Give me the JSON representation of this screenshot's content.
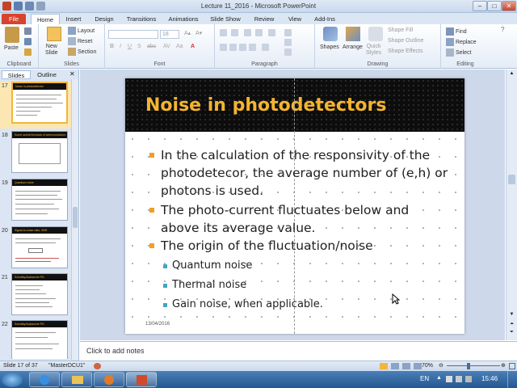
{
  "window": {
    "title": "Lecture 11_2016  -  Microsoft PowerPoint",
    "min": "–",
    "max": "□",
    "close": "✕"
  },
  "tabs": [
    "File",
    "Home",
    "Insert",
    "Design",
    "Transitions",
    "Animations",
    "Slide Show",
    "Review",
    "View",
    "Add-Ins"
  ],
  "ribbon": {
    "clipboard": {
      "label": "Clipboard",
      "paste": "Paste"
    },
    "slides": {
      "label": "Slides",
      "new_slide": "New\nSlide",
      "layout": "Layout",
      "reset": "Reset",
      "section": "Section"
    },
    "font": {
      "label": "Font",
      "size": "18"
    },
    "paragraph": {
      "label": "Paragraph"
    },
    "drawing": {
      "label": "Drawing",
      "shapes": "Shapes",
      "arrange": "Arrange",
      "quick_styles": "Quick\nStyles",
      "shape_fill": "Shape Fill",
      "shape_outline": "Shape Outline",
      "shape_effects": "Shape Effects"
    },
    "editing": {
      "label": "Editing",
      "find": "Find",
      "replace": "Replace",
      "select": "Select"
    }
  },
  "panel": {
    "tab_slides": "Slides",
    "tab_outline": "Outline",
    "thumbs": [
      {
        "num": "17",
        "title": "Noise in photodetector"
      },
      {
        "num": "18",
        "title": "Some useful formulas of semiconductors"
      },
      {
        "num": "19",
        "title": "Quantum noise"
      },
      {
        "num": "20",
        "title": "Signal-to-noise ratio, SNR"
      },
      {
        "num": "21",
        "title": "Schottky/Avalanche PD"
      },
      {
        "num": "22",
        "title": "Schottky/Avalanche PD"
      }
    ]
  },
  "slide": {
    "title": "Noise in photodetectors",
    "bullets": [
      "In the calculation of the responsivity of the",
      "photodetecor, the average number of (e,h) or",
      "photons is used.",
      "The photo-current fluctuates below and",
      "above its average value.",
      "The origin of the fluctuation/noise"
    ],
    "subbullets": [
      "Quantum noise",
      "Thermal noise",
      "Gain noise, when applicable."
    ],
    "date": "13/04/2016"
  },
  "notes": {
    "placeholder": "Click to add notes"
  },
  "status": {
    "slide": "Slide 17 of 37",
    "theme": "\"MasterDCU1\"",
    "zoom": "70%"
  },
  "taskbar": {
    "time": "15:46"
  },
  "colors": {
    "title_accent": "#f4b430",
    "bullet": "#f0a020",
    "subbullet": "#3fa6c8",
    "file_tab": "#d7432d"
  }
}
